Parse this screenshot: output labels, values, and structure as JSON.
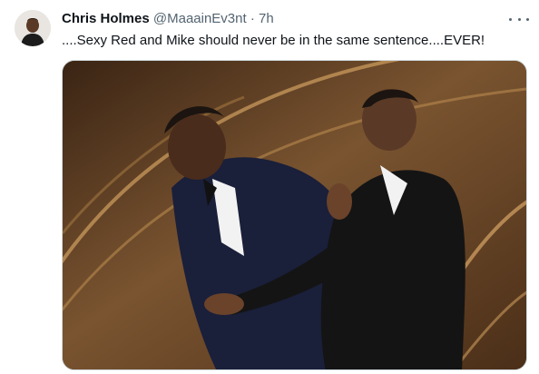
{
  "tweet": {
    "author_name": "Chris Holmes",
    "author_handle": "@MaaainEv3nt",
    "separator": "·",
    "time": "7h",
    "text": "....Sexy Red and Mike should never be in the same sentence....EVER!",
    "more_icon": "more-horizontal-icon"
  },
  "colors": {
    "text_primary": "#0f1419",
    "text_secondary": "#536471",
    "border": "#cfd9de"
  }
}
